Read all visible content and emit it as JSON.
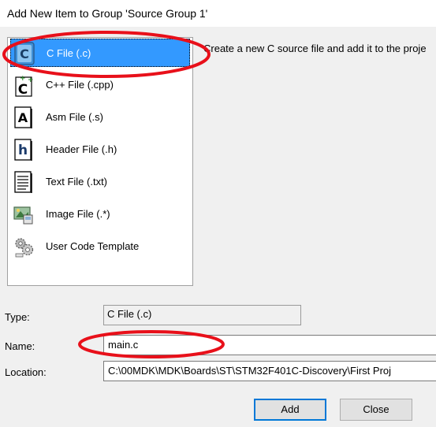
{
  "window": {
    "title": "Add New Item to Group 'Source Group 1'"
  },
  "file_types": [
    {
      "label": "C File (.c)",
      "icon": "c-file-icon",
      "selected": true
    },
    {
      "label": "C++ File (.cpp)",
      "icon": "cpp-file-icon",
      "selected": false
    },
    {
      "label": "Asm File (.s)",
      "icon": "asm-file-icon",
      "selected": false
    },
    {
      "label": "Header File (.h)",
      "icon": "header-file-icon",
      "selected": false
    },
    {
      "label": "Text File (.txt)",
      "icon": "text-file-icon",
      "selected": false
    },
    {
      "label": "Image File (.*)",
      "icon": "image-file-icon",
      "selected": false
    },
    {
      "label": "User Code Template",
      "icon": "code-template-icon",
      "selected": false
    }
  ],
  "description": "Create a new C source file and add it to the proje",
  "form": {
    "type_label": "Type:",
    "type_value": "C File (.c)",
    "name_label": "Name:",
    "name_value": "main.c",
    "location_label": "Location:",
    "location_value": "C:\\00MDK\\MDK\\Boards\\ST\\STM32F401C-Discovery\\First Proj"
  },
  "buttons": {
    "add": "Add",
    "close": "Close"
  },
  "colors": {
    "selection": "#3399ff",
    "annotation": "#e8101a",
    "dialog_bg": "#f0f0f0",
    "default_button_border": "#0078d7"
  }
}
